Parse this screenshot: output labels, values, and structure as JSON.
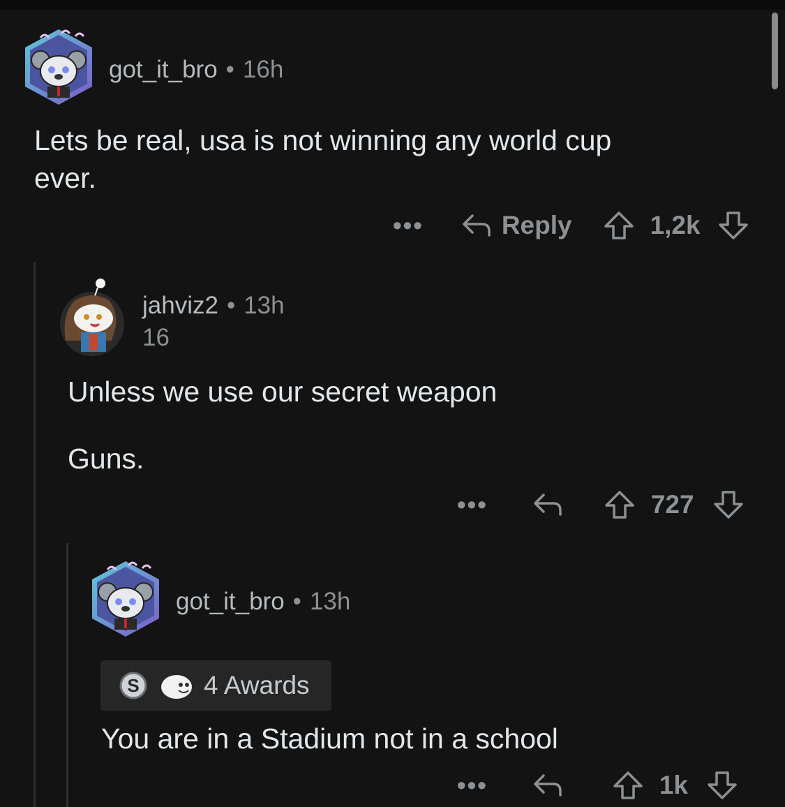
{
  "colors": {
    "background": "#131313",
    "text": "#e4e6e8",
    "meta": "#8e9092",
    "award_bg": "#262626"
  },
  "comments": [
    {
      "username": "got_it_bro",
      "time": "16h",
      "body": [
        "Lets be real, usa is not winning any world cup",
        "ever."
      ],
      "actions": {
        "more": "•••",
        "reply": "Reply",
        "score": "1,2k"
      }
    },
    {
      "username": "jahviz2",
      "time": "13h",
      "flair": "16",
      "body": [
        "Unless we use our secret weapon",
        "Guns."
      ],
      "actions": {
        "more": "•••",
        "score": "727"
      }
    },
    {
      "username": "got_it_bro",
      "time": "13h",
      "awards": "4 Awards",
      "body": [
        "You are in a Stadium not in a school"
      ],
      "actions": {
        "more": "•••",
        "score": "1k"
      }
    }
  ],
  "separator": "•",
  "icons": [
    "avatar-koala",
    "avatar-snoo",
    "reply-arrow-icon",
    "upvote-arrow-icon",
    "downvote-arrow-icon",
    "silver-award-icon",
    "wholesome-award-icon"
  ]
}
